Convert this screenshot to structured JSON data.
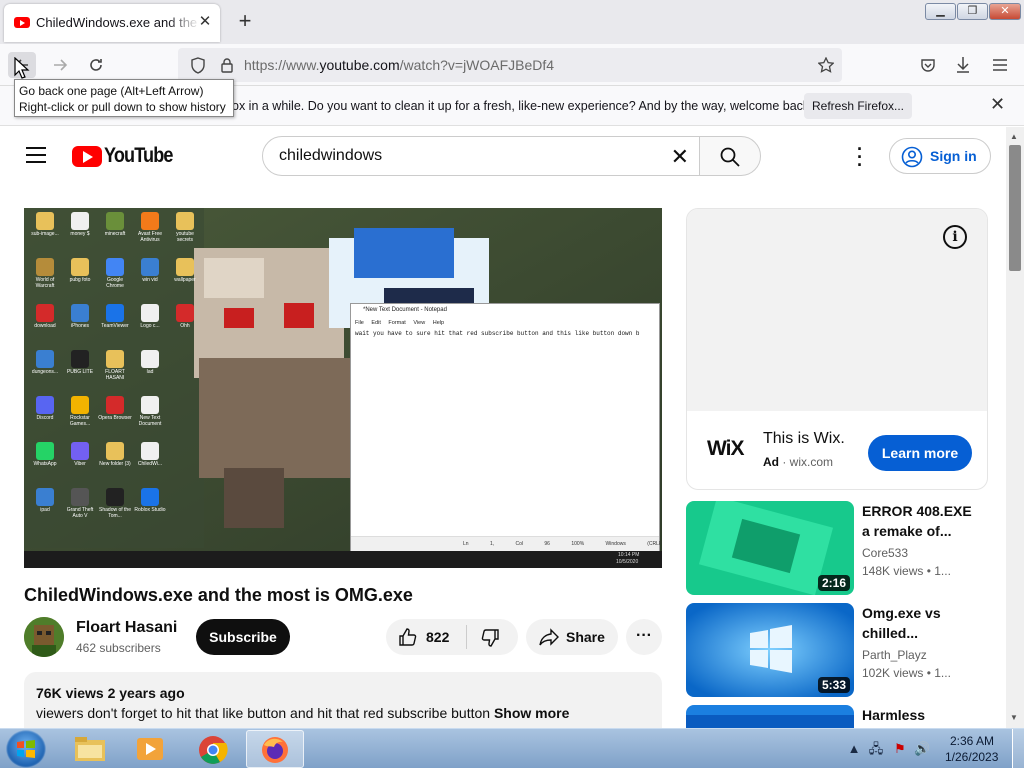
{
  "browser": {
    "tab_title": "ChiledWindows.exe and the most is OMG.exe",
    "url_prefix": "https://www.",
    "url_domain": "youtube.com",
    "url_path": "/watch?v=jWOAFJBeDf4",
    "tooltip_line1": "Go back one page (Alt+Left Arrow)",
    "tooltip_line2": "Right-click or pull down to show history",
    "notification_text": "ox in a while. Do you want to clean it up for a fresh, like-new experience? And by the way, welcome back!",
    "refresh_label": "Refresh Firefox..."
  },
  "youtube": {
    "logo_text": "YouTube",
    "search_value": "chiledwindows",
    "signin_label": "Sign in",
    "video": {
      "title": "ChiledWindows.exe and the most is OMG.exe",
      "channel": "Floart Hasani",
      "subscribers": "462 subscribers",
      "subscribe_label": "Subscribe",
      "likes": "822",
      "share_label": "Share",
      "views_date": "76K views  2 years ago",
      "description": "viewers don't forget to hit that like button and hit that red subscribe button",
      "show_more": "Show more"
    },
    "video_frame": {
      "notepad_title": "*New Text Document - Notepad",
      "notepad_menu": [
        "File",
        "Edit",
        "Format",
        "View",
        "Help"
      ],
      "notepad_text": "wait you have to sure hit that red subscribe button and this like button down b",
      "notepad_status": [
        "Ln 1, Col 96",
        "100%",
        "Windows (CRLF)",
        "UTF-8"
      ],
      "desktop_icons": [
        "sub-image...",
        "money $",
        "minecraft",
        "Avast Free Antivirus",
        "youtube secrets",
        "World of Warcraft",
        "pubg foto",
        "Google Chrome",
        "win vid",
        "wallpaper",
        "download",
        "iPhones",
        "TeamViewer",
        "Logo c...",
        "Ohh",
        "dungeons...",
        "PUBG LITE",
        "FLOART HASANI",
        "Iad",
        "",
        "Discord",
        "Rockstar Games...",
        "Opera Browser",
        "New Text Document",
        "",
        "WhatsApp",
        "Viber",
        "New folder (3)",
        "ChiledWi...",
        "",
        "ipad",
        "Grand Theft Auto V",
        "Shadow of the Tom...",
        "Roblox Studio",
        ""
      ],
      "taskbar_time": "10:14 PM",
      "taskbar_date": "10/5/2020"
    },
    "ad": {
      "logo": "WiX",
      "title": "This is Wix.",
      "ad_badge": "Ad",
      "domain": "wix.com",
      "cta": "Learn more"
    },
    "recommendations": [
      {
        "title": "ERROR 408.EXE a remake of...",
        "channel": "Core533",
        "views": "148K views",
        "age": "1...",
        "duration": "2:16"
      },
      {
        "title": "Omg.exe vs chilled...",
        "channel": "Parth_Playz",
        "views": "102K views",
        "age": "1...",
        "duration": "5:33"
      },
      {
        "title": "Harmless",
        "channel": "",
        "views": "",
        "age": "",
        "duration": ""
      }
    ]
  },
  "taskbar": {
    "time": "2:36 AM",
    "date": "1/26/2023"
  },
  "colors": {
    "youtube_red": "#ff0000",
    "link_blue": "#065fd4",
    "firefox_chrome": "#e9e9ed"
  }
}
